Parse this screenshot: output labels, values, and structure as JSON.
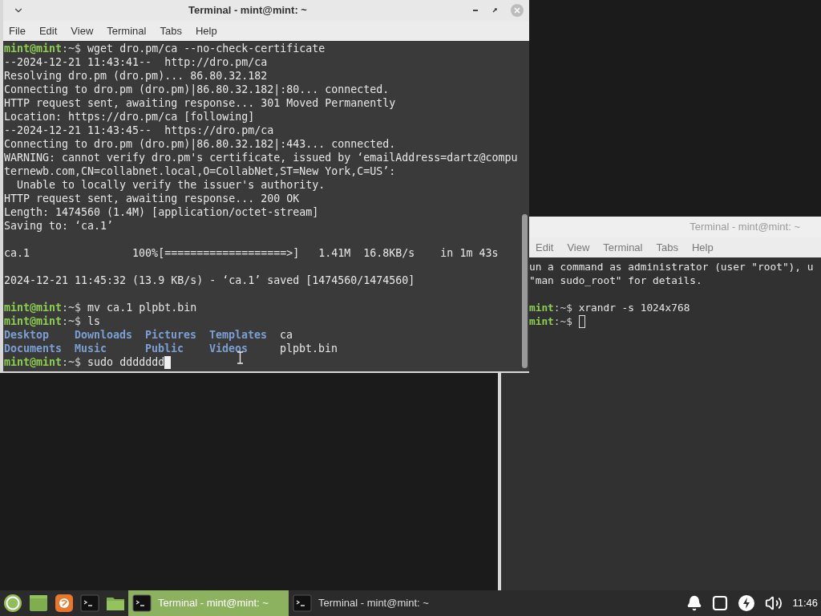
{
  "windows": [
    {
      "title": "Terminal - mint@mint: ~",
      "focused": true,
      "menu": [
        "File",
        "Edit",
        "View",
        "Terminal",
        "Tabs",
        "Help"
      ],
      "lines": [
        {
          "kind": "prompt",
          "prompt": "mint@mint",
          "path": ":~$",
          "command": " wget dro.pm/ca --no-check-certificate"
        },
        {
          "kind": "text",
          "text": "--2024-12-21 11:43:41--  http://dro.pm/ca"
        },
        {
          "kind": "text",
          "text": "Resolving dro.pm (dro.pm)... 86.80.32.182"
        },
        {
          "kind": "text",
          "text": "Connecting to dro.pm (dro.pm)|86.80.32.182|:80... connected."
        },
        {
          "kind": "text",
          "text": "HTTP request sent, awaiting response... 301 Moved Permanently"
        },
        {
          "kind": "text",
          "text": "Location: https://dro.pm/ca [following]"
        },
        {
          "kind": "text",
          "text": "--2024-12-21 11:43:45--  https://dro.pm/ca"
        },
        {
          "kind": "text",
          "text": "Connecting to dro.pm (dro.pm)|86.80.32.182|:443... connected."
        },
        {
          "kind": "text",
          "text": "WARNING: cannot verify dro.pm's certificate, issued by ‘emailAddress=dartz@compu"
        },
        {
          "kind": "text",
          "text": "ternewb.com,CN=collabnet.local,O=CollabNet,ST=New York,C=US’:"
        },
        {
          "kind": "text",
          "text": "  Unable to locally verify the issuer's authority."
        },
        {
          "kind": "text",
          "text": "HTTP request sent, awaiting response... 200 OK"
        },
        {
          "kind": "text",
          "text": "Length: 1474560 (1.4M) [application/octet-stream]"
        },
        {
          "kind": "text",
          "text": "Saving to: ‘ca.1’"
        },
        {
          "kind": "blank"
        },
        {
          "kind": "text",
          "text": "ca.1                100%[===================>]   1.41M  16.8KB/s    in 1m 43s"
        },
        {
          "kind": "blank"
        },
        {
          "kind": "text",
          "text": "2024-12-21 11:45:32 (13.9 KB/s) - ‘ca.1’ saved [1474560/1474560]"
        },
        {
          "kind": "blank"
        },
        {
          "kind": "prompt",
          "prompt": "mint@mint",
          "path": ":~$",
          "command": " mv ca.1 plpbt.bin"
        },
        {
          "kind": "prompt",
          "prompt": "mint@mint",
          "path": ":~$",
          "command": " ls"
        },
        {
          "kind": "listing",
          "entries": [
            {
              "name": "Desktop",
              "dir": true
            },
            {
              "name": "Downloads",
              "dir": true
            },
            {
              "name": "Pictures",
              "dir": true
            },
            {
              "name": "Templates",
              "dir": true
            },
            {
              "name": "ca",
              "dir": false
            }
          ]
        },
        {
          "kind": "listing",
          "entries": [
            {
              "name": "Documents",
              "dir": true
            },
            {
              "name": "Music",
              "dir": true
            },
            {
              "name": "Public",
              "dir": true
            },
            {
              "name": "Videos",
              "dir": true
            },
            {
              "name": "plpbt.bin",
              "dir": false
            }
          ]
        },
        {
          "kind": "prompt",
          "prompt": "mint@mint",
          "path": ":~$",
          "command": " sudo ddddddd",
          "cursor": true
        }
      ]
    },
    {
      "title": "Terminal - mint@mint: ~",
      "focused": false,
      "menu": [
        "Edit",
        "View",
        "Terminal",
        "Tabs",
        "Help"
      ],
      "lines": [
        {
          "kind": "text",
          "text": "un a command as administrator (user \"root\"), u"
        },
        {
          "kind": "text",
          "text": "\"man sudo_root\" for details."
        },
        {
          "kind": "blank"
        },
        {
          "kind": "prompt",
          "prompt": "mint",
          "path": ":~$",
          "command": " xrandr -s 1024x768"
        },
        {
          "kind": "prompt",
          "prompt": "mint",
          "path": ":~$",
          "cursor": true
        }
      ]
    }
  ],
  "taskbar": {
    "launchers": [
      {
        "kind": "menu"
      },
      {
        "kind": "desktop"
      },
      {
        "kind": "browser"
      },
      {
        "kind": "terminal"
      },
      {
        "kind": "files"
      }
    ],
    "window_buttons": [
      {
        "label": "Terminal - mint@mint: ~",
        "selected": true
      },
      {
        "label": "Terminal - mint@mint: ~",
        "selected": false
      }
    ],
    "tray": [
      {
        "kind": "notifications"
      },
      {
        "kind": "workspace"
      },
      {
        "kind": "power"
      },
      {
        "kind": "volume"
      }
    ],
    "clock": "11:46"
  }
}
